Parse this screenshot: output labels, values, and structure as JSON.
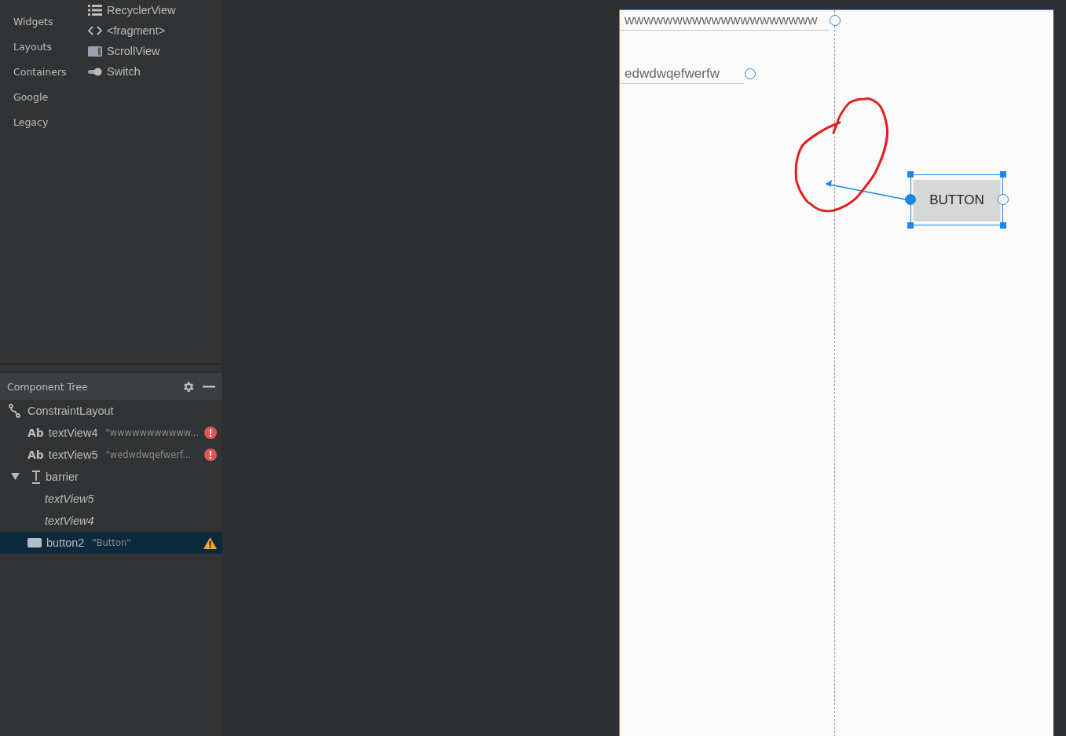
{
  "palette": {
    "categories": [
      "Widgets",
      "Layouts",
      "Containers",
      "Google",
      "Legacy"
    ],
    "items": [
      {
        "label": "RecyclerView",
        "kind": "list"
      },
      {
        "label": "<fragment>",
        "kind": "code"
      },
      {
        "label": "ScrollView",
        "kind": "scroll"
      },
      {
        "label": "Switch",
        "kind": "switch"
      }
    ]
  },
  "component_tree": {
    "title": "Component Tree",
    "nodes": [
      {
        "kind": "constraint",
        "label": "ConstraintLayout",
        "selected": false,
        "children": [
          {
            "kind": "text",
            "icon_text": "Ab",
            "label": "textView4",
            "detail": "\"wwwwwwwwwww...",
            "error": true,
            "warning": false,
            "selected": false
          },
          {
            "kind": "text",
            "icon_text": "Ab",
            "label": "textView5",
            "detail": "\"wedwdwqefwerf...",
            "error": true,
            "warning": false,
            "selected": false
          },
          {
            "kind": "barrier",
            "label": "barrier",
            "expanded": true,
            "selected": false,
            "children": [
              {
                "kind": "reference",
                "label": "textView5",
                "selected": false
              },
              {
                "kind": "reference",
                "label": "textView4",
                "selected": false
              }
            ]
          },
          {
            "kind": "button",
            "label": "button2",
            "detail": "\"Button\"",
            "error": false,
            "warning": true,
            "selected": true
          }
        ]
      }
    ]
  },
  "design": {
    "text_views": [
      {
        "text": "wwwwwwwwwwwwwwwwwwww"
      },
      {
        "text": "edwdwqefwerfw"
      }
    ],
    "button": {
      "label": "BUTTON",
      "selected": true
    }
  }
}
